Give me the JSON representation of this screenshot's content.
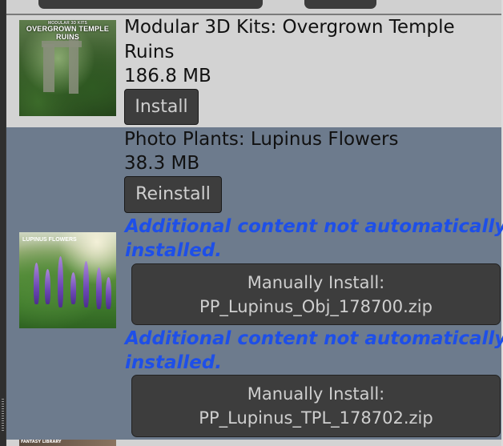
{
  "items": [
    {
      "thumbnail_caption_small": "MODULAR 3D KITS",
      "thumbnail_caption": "OVERGROWN TEMPLE RUINS",
      "title_line1": "Modular 3D Kits: Overgrown Temple",
      "title_line2": "Ruins",
      "size": "186.8 MB",
      "button_label": "Install"
    },
    {
      "thumbnail_caption": "LUPINUS FLOWERS",
      "title": "Photo Plants: Lupinus Flowers",
      "size": "38.3 MB",
      "button_label": "Reinstall",
      "additional": [
        {
          "note_line1": "Additional content not automatically",
          "note_line2": "installed.",
          "button_line1": "Manually Install:",
          "button_line2": "PP_Lupinus_Obj_178700.zip"
        },
        {
          "note_line1": "Additional content not automatically",
          "note_line2": "installed.",
          "button_line1": "Manually Install:",
          "button_line2": "PP_Lupinus_TPL_178702.zip"
        }
      ]
    },
    {
      "thumbnail_caption": "FANTASY LIBRARY"
    }
  ],
  "colors": {
    "selected_row_bg": "#6d7b8d",
    "row_bg": "#d3d3d3",
    "button_bg": "#3d3d3d",
    "note_text": "#1e4fe8"
  }
}
